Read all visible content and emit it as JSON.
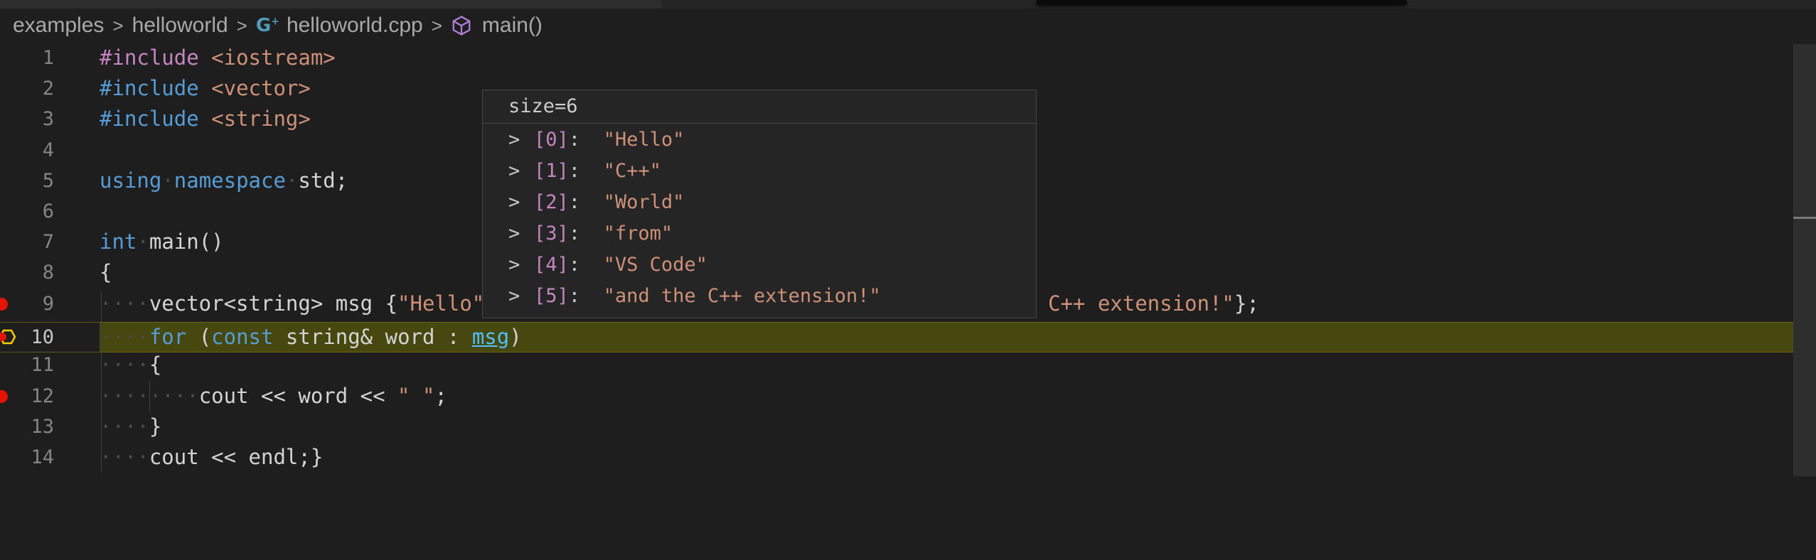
{
  "breadcrumb": {
    "items": [
      {
        "label": "examples"
      },
      {
        "label": "helloworld"
      },
      {
        "label": "helloworld.cpp",
        "icon": "cpp-file-icon"
      },
      {
        "label": "main()",
        "icon": "cube-method-icon"
      }
    ],
    "separator": ">"
  },
  "editor": {
    "line_numbers": [
      "1",
      "2",
      "3",
      "4",
      "5",
      "6",
      "7",
      "8",
      "9",
      "10",
      "11",
      "12",
      "13",
      "14"
    ],
    "active_line": "10",
    "breakpoint_lines": [
      "9",
      "12"
    ],
    "paused_line": "10",
    "tokens": {
      "include": "#include",
      "iostream": "<iostream>",
      "vector_hdr": "<vector>",
      "string_hdr": "<string>",
      "using": "using",
      "namespace": "namespace",
      "std": "std;",
      "int": "int",
      "main": "main()",
      "open_brace": "{",
      "l9_a": "vector<string> msg {",
      "l9_b": "\"Hello\"",
      "l9_c": "C++ extension!\"",
      "l9_d": "};",
      "for": "for",
      "lparen": " (",
      "const": "const",
      "l10_mid": " string& word : ",
      "msg": "msg",
      "rparen": ")",
      "l12_a": "cout << word << ",
      "l12_str": "\" \"",
      "l12_end": ";",
      "close_brace": "}",
      "l14": "cout << endl;}"
    }
  },
  "hover": {
    "title": "size=6",
    "items": [
      {
        "index": "[0]",
        "value": "\"Hello\""
      },
      {
        "index": "[1]",
        "value": "\"C++\""
      },
      {
        "index": "[2]",
        "value": "\"World\""
      },
      {
        "index": "[3]",
        "value": "\"from\""
      },
      {
        "index": "[4]",
        "value": "\"VS Code\""
      },
      {
        "index": "[5]",
        "value": "\"and the C++ extension!\""
      }
    ]
  },
  "colors": {
    "background": "#1e1e1e",
    "keyword": "#569cd6",
    "string": "#ce9178",
    "breakpoint": "#e51400",
    "highlight": "#7a7a00"
  }
}
